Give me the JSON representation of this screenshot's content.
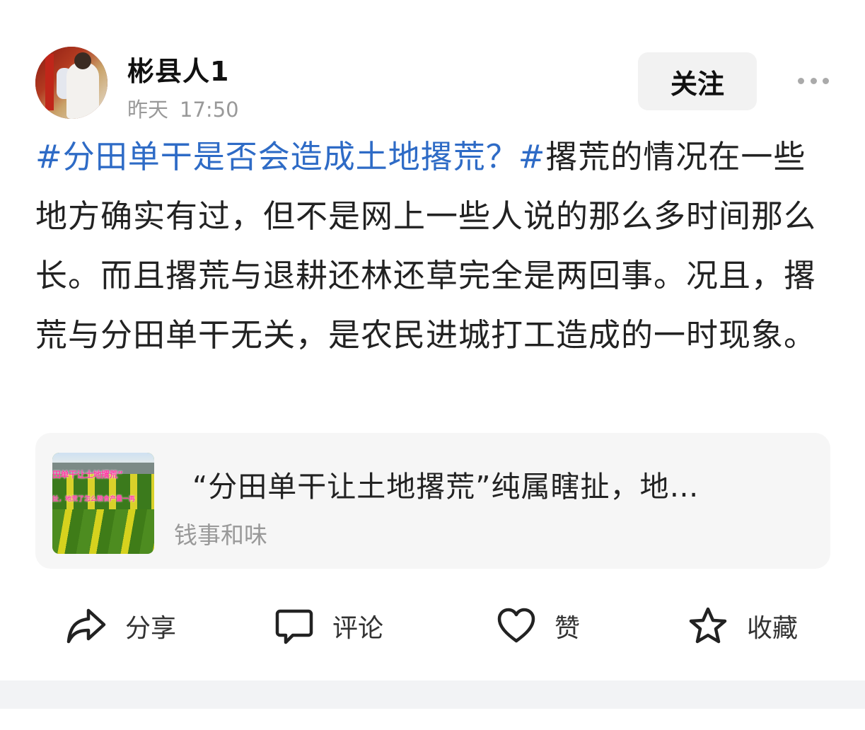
{
  "author": {
    "name": "彬县人1",
    "time_day": "昨天",
    "time_clock": "17:50"
  },
  "follow_label": "关注",
  "more_icon": "more-horizontal-icon",
  "post": {
    "hashtag": "#分田单干是否会造成土地撂荒？#",
    "text": "撂荒的情况在一些地方确实有过，但不是网上一些人说的那么多时间那么长。而且撂荒与退耕还林还草完全是两回事。况且，撂荒与分田单干无关，是农民进城打工造成的一时现象。"
  },
  "link_card": {
    "thumb_caption": "田单干让土地撂荒”",
    "thumb_subcaption": "扯，地荒了怎么粮食产量一再",
    "title": "“分田单干让土地撂荒”纯属瞎扯，地…",
    "source": "钱事和味"
  },
  "actions": {
    "share": "分享",
    "comment": "评论",
    "like": "赞",
    "favorite": "收藏"
  },
  "colors": {
    "hashtag": "#2e6bc6",
    "text": "#222222",
    "muted": "#999999"
  }
}
